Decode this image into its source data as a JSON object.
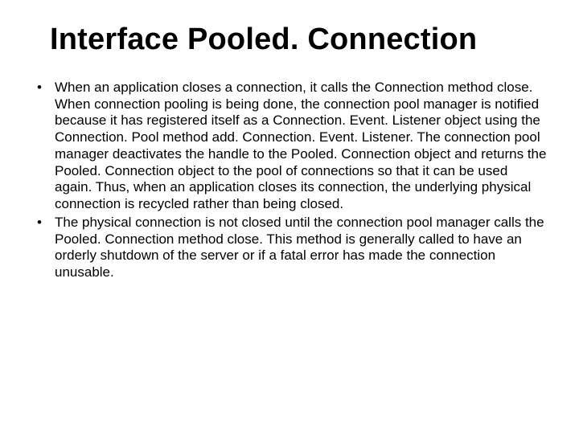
{
  "title": "Interface Pooled. Connection",
  "bullets": [
    "When an application closes a connection, it calls the Connection method close. When connection pooling is being done, the connection pool manager is notified because it has registered itself as a Connection. Event. Listener object using the Connection. Pool method add. Connection. Event. Listener. The connection pool manager deactivates the handle to the Pooled. Connection object and returns the Pooled. Connection object to the pool of connections so that it can be used again. Thus, when an application closes its connection, the underlying physical connection is recycled rather than being closed.",
    "The physical connection is not closed until the connection pool manager calls the Pooled. Connection method close. This method is generally called to have an orderly shutdown of the server or if a fatal error has made the connection unusable."
  ]
}
